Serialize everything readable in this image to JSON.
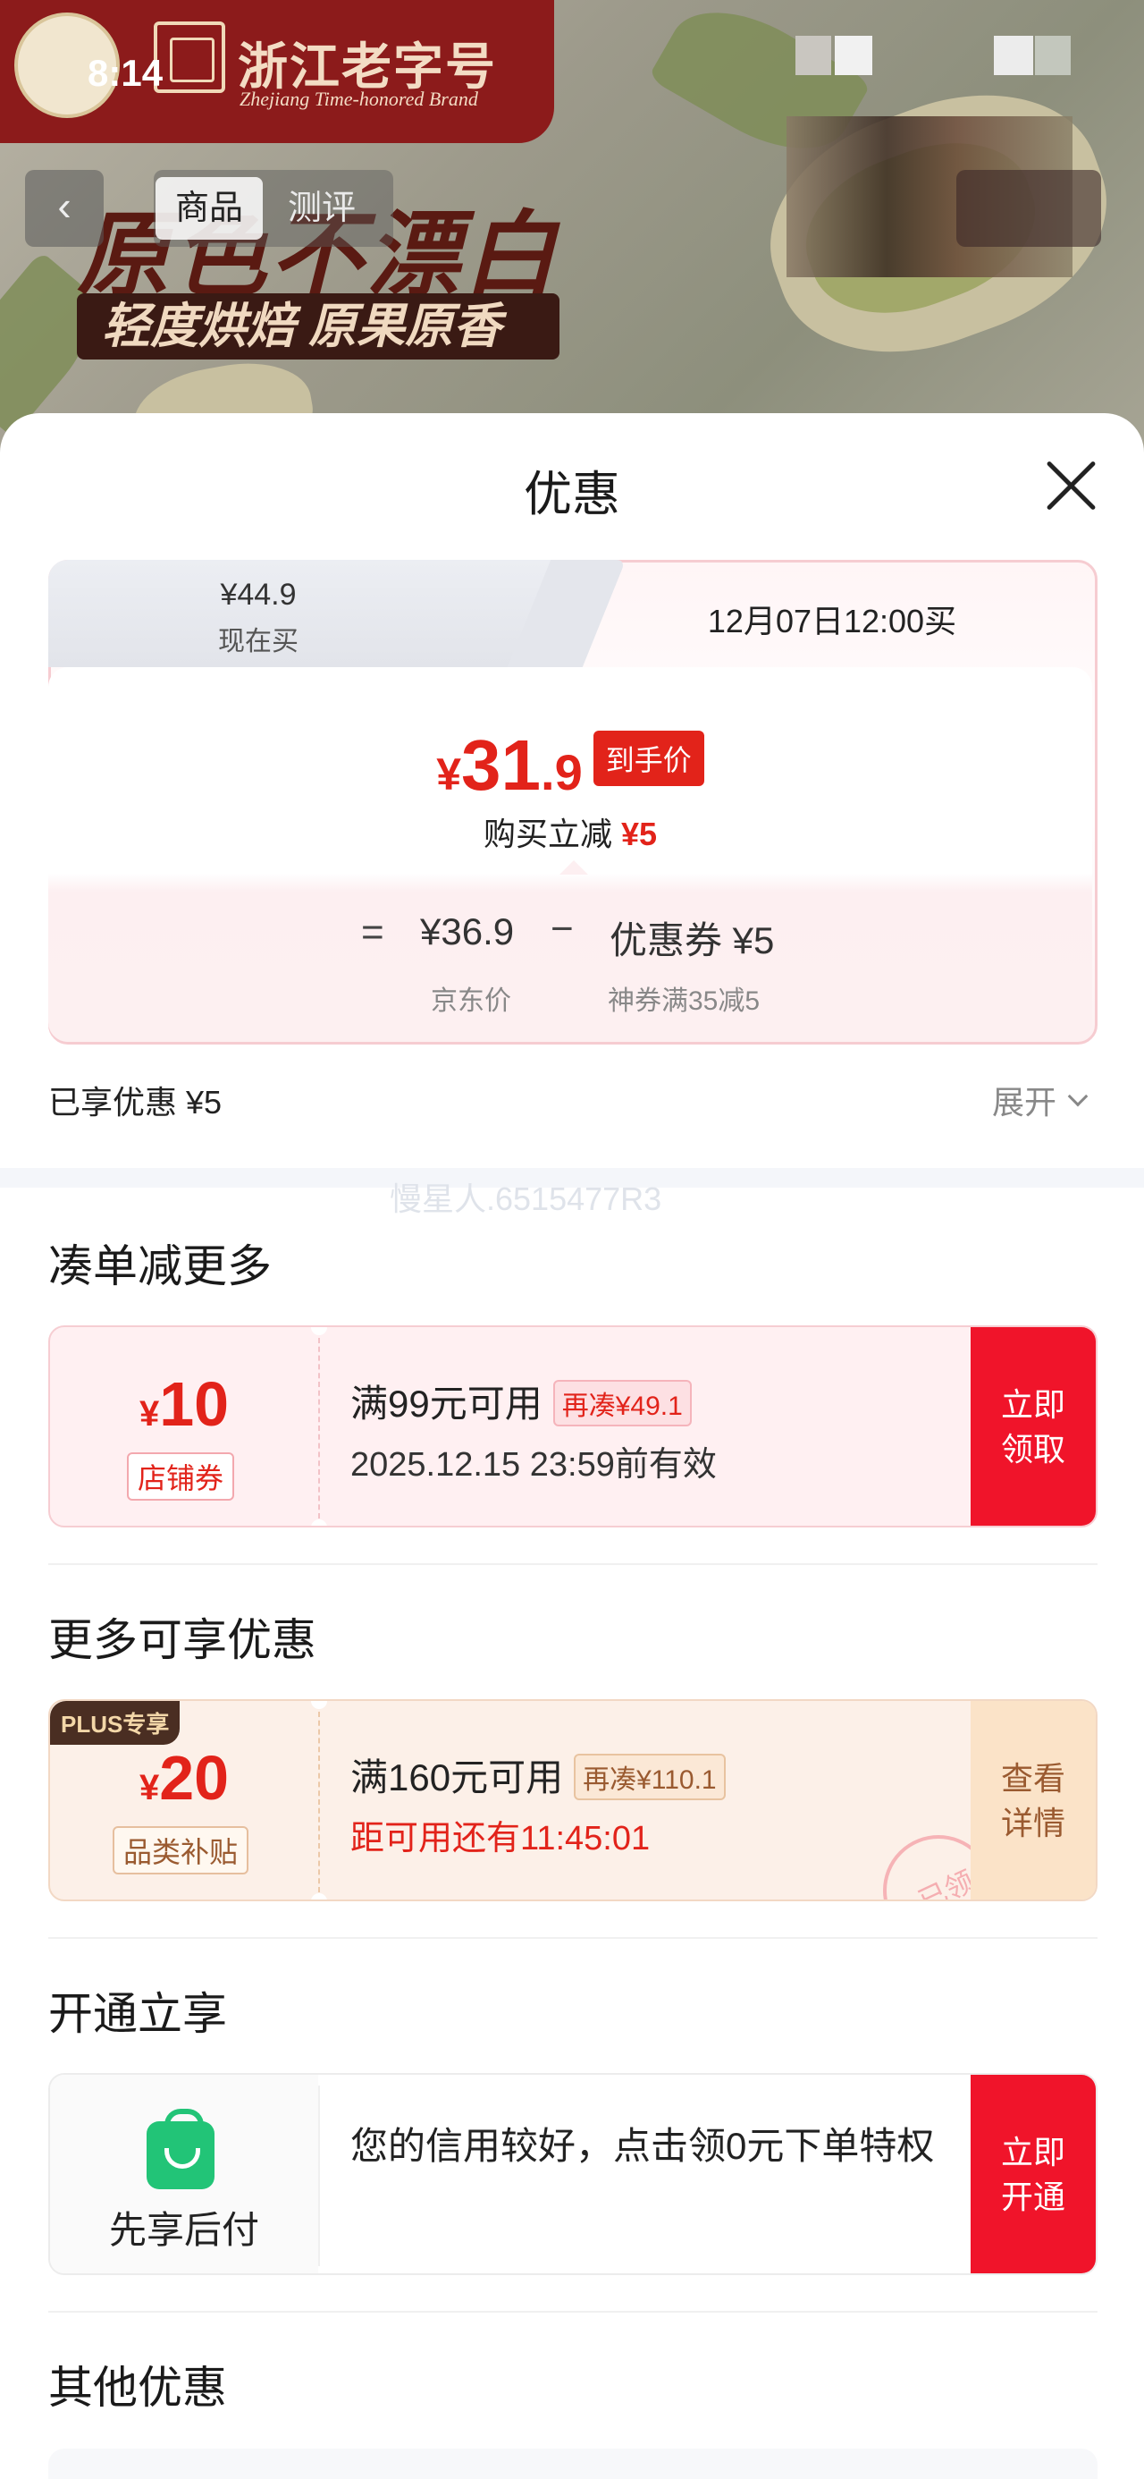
{
  "status_bar": {
    "time": "8:14"
  },
  "banner": {
    "brand_cn": "浙江老字号",
    "brand_en": "Zhejiang Time-honored Brand",
    "slogan": "原色不漂白",
    "sub_slogan": "轻度烘焙 原果原香"
  },
  "nav": {
    "back_icon": "chevron-left-icon",
    "tabs": [
      {
        "label": "商品",
        "active": true
      },
      {
        "label": "测评",
        "active": false
      }
    ]
  },
  "sheet": {
    "title": "优惠",
    "close_icon": "close-icon"
  },
  "price_card": {
    "now_tab": {
      "price": "¥44.9",
      "label": "现在买"
    },
    "later_tab": {
      "label": "12月07日12:00买"
    },
    "final": {
      "yen": "¥",
      "integer": "31",
      "decimal": ".9",
      "badge": "到手价"
    },
    "instant_cut": {
      "label": "购买立减",
      "amount": "¥5"
    },
    "calc": {
      "eq": "=",
      "jd_price": "¥36.9",
      "minus": "−",
      "coupon": "优惠券 ¥5",
      "jd_label": "京东价",
      "coupon_label": "神券满35减5"
    }
  },
  "enjoyed": {
    "label": "已享优惠 ¥5",
    "expand": "展开"
  },
  "watermark": "慢星人.6515477R3",
  "sections": {
    "more_order": {
      "title": "凑单减更多",
      "coupon": {
        "yen": "¥",
        "amount": "10",
        "tag": "店铺券",
        "condition": "满99元可用",
        "extra": "再凑¥49.1",
        "validity": "2025.12.15 23:59前有效",
        "button": [
          "立即",
          "领取"
        ]
      }
    },
    "more_benefits": {
      "title": "更多可享优惠",
      "coupon": {
        "badge": "PLUS专享",
        "yen": "¥",
        "amount": "20",
        "tag": "品类补贴",
        "condition": "满160元可用",
        "extra": "再凑¥110.1",
        "countdown": "距可用还有11:45:01",
        "stamp": "已领",
        "button": [
          "查看",
          "详情"
        ]
      }
    },
    "open_now": {
      "title": "开通立享",
      "card": {
        "icon": "shopping-bag-icon",
        "label": "先享后付",
        "text": "您的信用较好，点击领0元下单特权",
        "button": [
          "立即",
          "开通"
        ]
      }
    },
    "other": {
      "title": "其他优惠"
    }
  },
  "colors": {
    "accent_red": "#e2231a",
    "button_red": "#f0142a",
    "plus_brown": "#4a2e22",
    "green": "#22c477"
  }
}
